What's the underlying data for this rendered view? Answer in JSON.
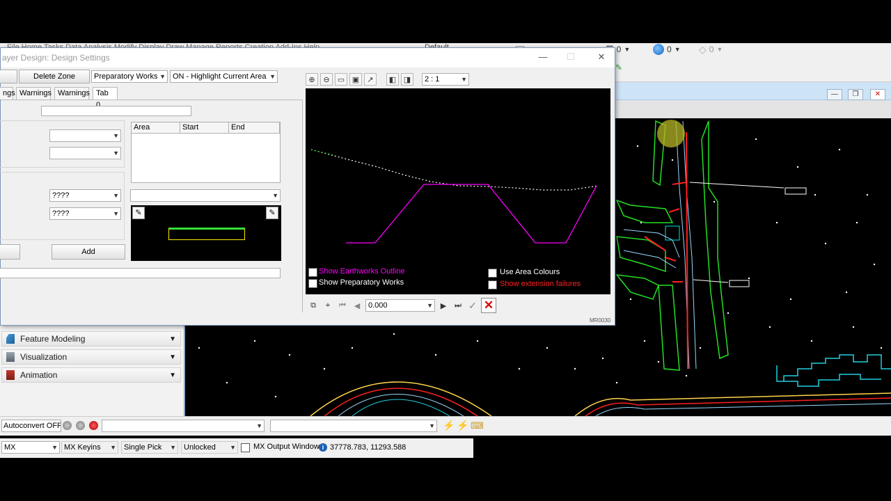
{
  "app": {
    "menu_text": "File  Home  Tasks  Data  Analysis  Modify  Display  Draw  Manage  Reports  Creation  Add-Ins  Help",
    "toolbar_counts": [
      "0",
      "0",
      "0"
    ],
    "style_combo": "Default"
  },
  "dialog": {
    "title": "ayer Design: Design Settings",
    "controls": {
      "minimize": "—",
      "maximize": "☐",
      "close": "✕"
    },
    "delete_zone_label": "Delete Zone",
    "preparatory_works_select": "Preparatory Works",
    "highlight_select": "ON - Highlight Current Area",
    "tabs": [
      "ngs",
      "Warnings",
      "Warnings",
      "Tab 0"
    ],
    "area_table": {
      "columns": [
        "Area",
        "Start",
        "End"
      ]
    },
    "combo_a": "????",
    "combo_b": "????",
    "add_label": "Add",
    "preview_toolbar": {
      "scale": "2 : 1"
    },
    "checks": {
      "earthworks_outline": "Show Earthworks Outline",
      "preparatory_works": "Show Preparatory Works",
      "area_colours": "Use Area Colours",
      "extension_failures": "Show extension failures"
    },
    "chainage_value": "0.000",
    "footer_code": "MR0030",
    "colors": {
      "earthworks": "#ff00ff",
      "extension_failures": "#ff0000",
      "profile": "#ffffff"
    }
  },
  "explorer": {
    "items": [
      {
        "label": "Feature Modeling",
        "icon": "feature-modeling-icon"
      },
      {
        "label": "Visualization",
        "icon": "visualization-icon"
      },
      {
        "label": "Animation",
        "icon": "animation-icon"
      }
    ]
  },
  "status": {
    "autoconvert_label": "Autoconvert OFF",
    "mode_select": "MX",
    "keyins_select": "MX Keyins",
    "pick_select": "Single Pick",
    "lock_select": "Unlocked",
    "output_window_label": "MX Output Window",
    "coordinates": "37778.783, 11293.588"
  }
}
